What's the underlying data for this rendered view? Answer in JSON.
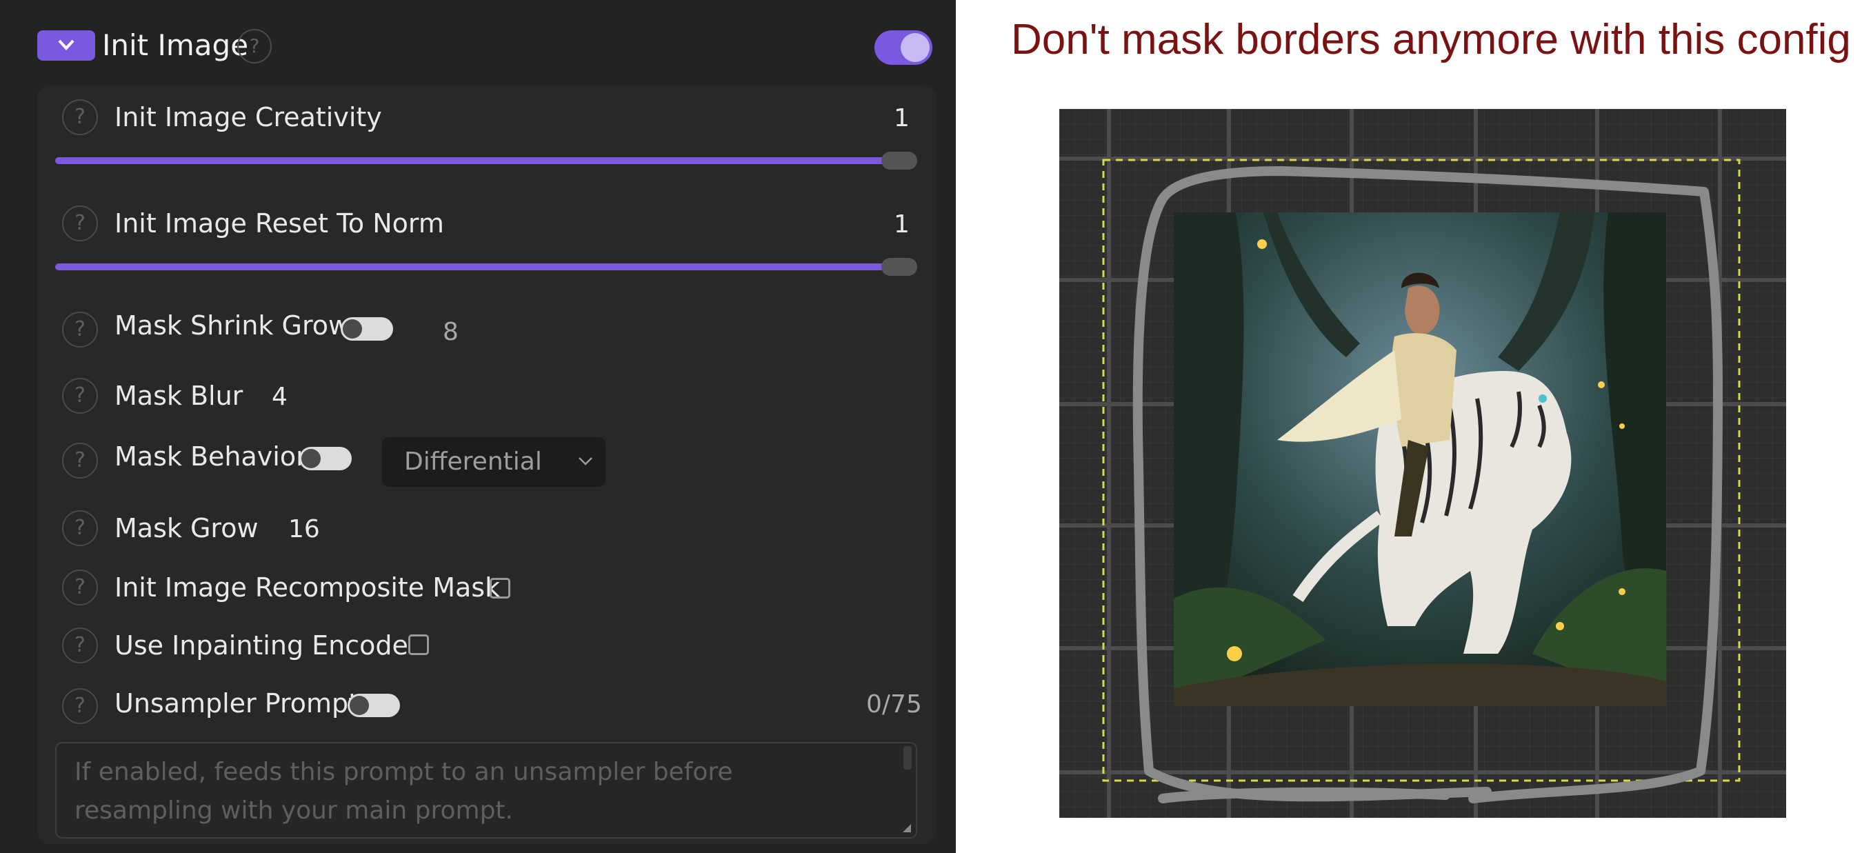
{
  "panel": {
    "title": "Init Image",
    "help_glyph": "?",
    "enabled": true,
    "collapse_icon": "chevron-down-icon",
    "accent_color": "#7a59e0"
  },
  "params": {
    "creativity": {
      "label": "Init Image Creativity",
      "value": "1",
      "slider_fraction": 1.0
    },
    "reset_to_norm": {
      "label": "Init Image Reset To Norm",
      "value": "1",
      "slider_fraction": 1.0
    },
    "mask_shrink_grow": {
      "label": "Mask Shrink Grow",
      "value": "8",
      "enabled": false
    },
    "mask_blur": {
      "label": "Mask Blur",
      "value": "4"
    },
    "mask_behavior": {
      "label": "Mask Behavior",
      "selected": "Differential",
      "enabled": false
    },
    "mask_grow": {
      "label": "Mask Grow",
      "value": "16"
    },
    "recomposite_mask": {
      "label": "Init Image Recomposite Mask",
      "checked": false
    },
    "inpainting_encode": {
      "label": "Use Inpainting Encode",
      "checked": false
    },
    "unsampler_prompt": {
      "label": "Unsampler Prompt",
      "enabled": false,
      "counter": "0/75",
      "placeholder": "If enabled, feeds this prompt to an unsampler before resampling with your main prompt."
    }
  },
  "annotation": {
    "caption": "Don't mask borders anymore with this config",
    "caption_color": "#7a1212",
    "mask_stroke_color": "#8a8a8a",
    "selection_border_color": "#d8d84a"
  }
}
